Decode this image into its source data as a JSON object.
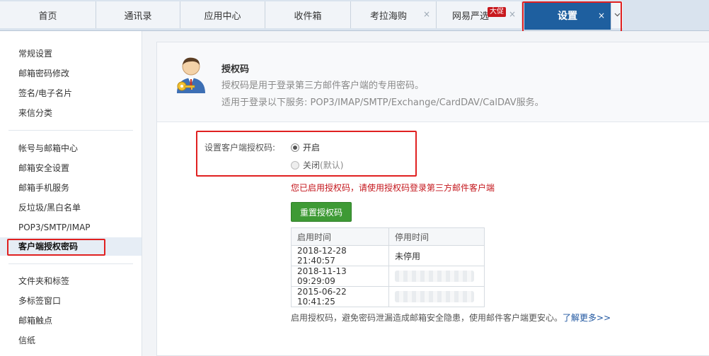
{
  "tabs": [
    {
      "label": "首页"
    },
    {
      "label": "通讯录"
    },
    {
      "label": "应用中心"
    },
    {
      "label": "收件箱"
    },
    {
      "label": "考拉海购",
      "close": "×"
    },
    {
      "label": "网易严选",
      "badge": "大促",
      "close": "×"
    },
    {
      "label": "设置",
      "close": "×"
    }
  ],
  "tab_more_icon": "chevron-down",
  "sidebar": {
    "group1": [
      "常规设置",
      "邮箱密码修改",
      "签名/电子名片",
      "来信分类"
    ],
    "group2": [
      "帐号与邮箱中心",
      "邮箱安全设置",
      "邮箱手机服务",
      "反垃圾/黑白名单",
      "POP3/SMTP/IMAP",
      "客户端授权密码"
    ],
    "group3": [
      "文件夹和标签",
      "多标签窗口",
      "邮箱触点",
      "信纸"
    ]
  },
  "intro": {
    "title": "授权码",
    "desc1": "授权码是用于登录第三方邮件客户端的专用密码。",
    "desc2": "适用于登录以下服务: POP3/IMAP/SMTP/Exchange/CardDAV/CalDAV服务。"
  },
  "setting": {
    "label": "设置客户端授权码:",
    "option_on": "开启",
    "option_off": "关闭",
    "option_off_default": "(默认)",
    "selected": "开启"
  },
  "warning": "您已启用授权码，请使用授权码登录第三方邮件客户端",
  "reset_button": "重置授权码",
  "log_table": {
    "headers": [
      "启用时间",
      "停用时间"
    ],
    "rows": [
      [
        "2018-12-28 21:40:57",
        "未停用"
      ],
      [
        "2018-11-13 09:29:09",
        ""
      ],
      [
        "2015-06-22 10:41:25",
        ""
      ]
    ]
  },
  "footer": {
    "text": "启用授权码，避免密码泄漏造成邮箱安全隐患，使用邮件客户端更安心。",
    "link": "了解更多>>"
  },
  "colors": {
    "active_tab": "#1e5f9f",
    "highlight_box": "#e02020",
    "warning": "#c4161c",
    "reset_button": "#3e9a35",
    "link": "#1f56a0"
  }
}
